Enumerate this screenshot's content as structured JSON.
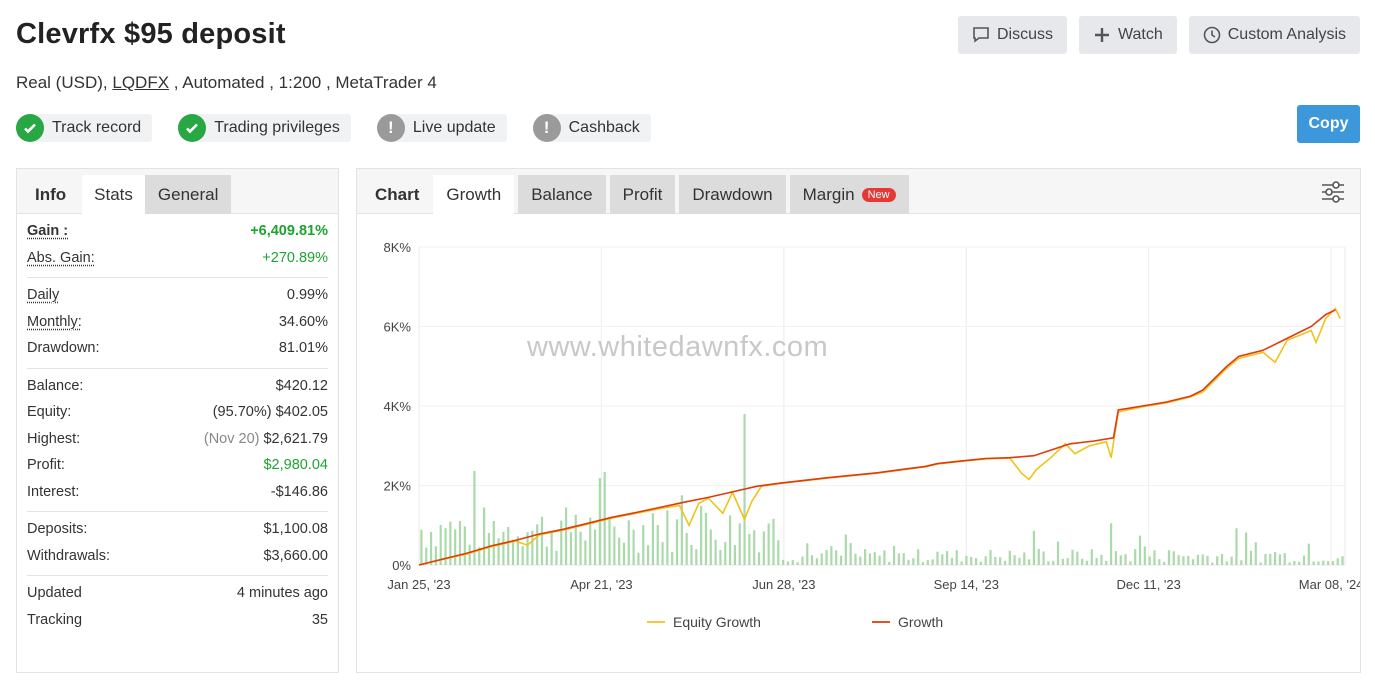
{
  "header": {
    "title": "Clevrfx $95 deposit",
    "account_type": "Real (USD),",
    "broker": "LQDFX",
    "details": ", Automated , 1:200 , MetaTrader 4"
  },
  "actions": {
    "discuss": "Discuss",
    "watch": "Watch",
    "custom_analysis": "Custom Analysis",
    "copy": "Copy"
  },
  "badges": [
    {
      "label": "Track record",
      "status": "ok"
    },
    {
      "label": "Trading privileges",
      "status": "ok"
    },
    {
      "label": "Live update",
      "status": "warn"
    },
    {
      "label": "Cashback",
      "status": "warn"
    }
  ],
  "left_tabs": {
    "info": "Info",
    "stats": "Stats",
    "general": "General"
  },
  "stats": {
    "gain_label": "Gain :",
    "gain": "+6,409.81%",
    "abs_gain_label": "Abs. Gain:",
    "abs_gain": "+270.89%",
    "daily_label": "Daily",
    "daily": "0.99%",
    "monthly_label": "Monthly:",
    "monthly": "34.60%",
    "drawdown_label": "Drawdown:",
    "drawdown": "81.01%",
    "balance_label": "Balance:",
    "balance": "$420.12",
    "equity_label": "Equity:",
    "equity_pct": "(95.70%)",
    "equity": "$402.05",
    "highest_label": "Highest:",
    "highest_date": "(Nov 20)",
    "highest": "$2,621.79",
    "profit_label": "Profit:",
    "profit": "$2,980.04",
    "interest_label": "Interest:",
    "interest": "-$146.86",
    "deposits_label": "Deposits:",
    "deposits": "$1,100.08",
    "withdrawals_label": "Withdrawals:",
    "withdrawals": "$3,660.00",
    "updated_label": "Updated",
    "updated": "4 minutes ago",
    "tracking_label": "Tracking",
    "tracking": "35"
  },
  "chart_tabs": {
    "chart": "Chart",
    "growth": "Growth",
    "balance": "Balance",
    "profit": "Profit",
    "drawdown": "Drawdown",
    "margin": "Margin",
    "new_badge": "New"
  },
  "watermark": "www.whitedawnfx.com",
  "colors": {
    "growth": "#e03a0c",
    "equity": "#f2c21b",
    "bars": "#9bd49b",
    "accent": "#3d97db",
    "ok": "#27a844"
  },
  "chart_data": {
    "type": "line",
    "y_ticks": [
      "0%",
      "2K%",
      "4K%",
      "6K%",
      "8K%"
    ],
    "ylim": [
      0,
      8000
    ],
    "x_ticks": [
      "Jan 25, '23",
      "Apr 21, '23",
      "Jun 28, '23",
      "Sep 14, '23",
      "Dec 11, '23",
      "Mar 08, '24"
    ],
    "legend": [
      "Equity Growth",
      "Growth"
    ],
    "series": [
      {
        "name": "Growth",
        "points": [
          [
            0,
            0
          ],
          [
            10,
            150
          ],
          [
            20,
            300
          ],
          [
            30,
            480
          ],
          [
            40,
            620
          ],
          [
            50,
            780
          ],
          [
            60,
            900
          ],
          [
            70,
            1050
          ],
          [
            80,
            1200
          ],
          [
            90,
            1320
          ],
          [
            100,
            1450
          ],
          [
            110,
            1580
          ],
          [
            120,
            1700
          ],
          [
            130,
            1840
          ],
          [
            140,
            1980
          ],
          [
            150,
            2060
          ],
          [
            160,
            2130
          ],
          [
            170,
            2200
          ],
          [
            180,
            2260
          ],
          [
            190,
            2320
          ],
          [
            200,
            2400
          ],
          [
            210,
            2480
          ],
          [
            215,
            2550
          ],
          [
            225,
            2620
          ],
          [
            235,
            2680
          ],
          [
            245,
            2700
          ],
          [
            255,
            2750
          ],
          [
            265,
            2950
          ],
          [
            270,
            3050
          ],
          [
            280,
            3120
          ],
          [
            288,
            3200
          ],
          [
            290,
            3900
          ],
          [
            300,
            4000
          ],
          [
            310,
            4100
          ],
          [
            320,
            4250
          ],
          [
            325,
            4400
          ],
          [
            330,
            4700
          ],
          [
            335,
            5000
          ],
          [
            340,
            5250
          ],
          [
            350,
            5400
          ],
          [
            360,
            5700
          ],
          [
            370,
            6000
          ],
          [
            376,
            6300
          ],
          [
            380,
            6420
          ]
        ]
      },
      {
        "name": "Equity Growth",
        "points": [
          [
            0,
            0
          ],
          [
            10,
            140
          ],
          [
            20,
            280
          ],
          [
            30,
            460
          ],
          [
            40,
            600
          ],
          [
            45,
            500
          ],
          [
            50,
            760
          ],
          [
            60,
            880
          ],
          [
            70,
            1030
          ],
          [
            80,
            1180
          ],
          [
            90,
            1300
          ],
          [
            100,
            1420
          ],
          [
            108,
            1500
          ],
          [
            112,
            1000
          ],
          [
            116,
            1550
          ],
          [
            120,
            1680
          ],
          [
            126,
            1300
          ],
          [
            130,
            1830
          ],
          [
            135,
            1150
          ],
          [
            138,
            1600
          ],
          [
            142,
            1980
          ],
          [
            150,
            2050
          ],
          [
            160,
            2120
          ],
          [
            170,
            2190
          ],
          [
            180,
            2250
          ],
          [
            190,
            2310
          ],
          [
            200,
            2390
          ],
          [
            210,
            2470
          ],
          [
            215,
            2540
          ],
          [
            225,
            2610
          ],
          [
            235,
            2670
          ],
          [
            245,
            2690
          ],
          [
            250,
            2300
          ],
          [
            253,
            2150
          ],
          [
            256,
            2400
          ],
          [
            262,
            2700
          ],
          [
            268,
            3050
          ],
          [
            272,
            2800
          ],
          [
            278,
            3000
          ],
          [
            285,
            3100
          ],
          [
            287,
            2700
          ],
          [
            290,
            3850
          ],
          [
            300,
            3980
          ],
          [
            310,
            4080
          ],
          [
            320,
            4230
          ],
          [
            325,
            4350
          ],
          [
            330,
            4650
          ],
          [
            335,
            4950
          ],
          [
            340,
            5200
          ],
          [
            350,
            5350
          ],
          [
            355,
            5100
          ],
          [
            360,
            5650
          ],
          [
            370,
            5900
          ],
          [
            372,
            5600
          ],
          [
            376,
            6200
          ],
          [
            380,
            6450
          ],
          [
            382,
            6200
          ]
        ]
      }
    ]
  }
}
